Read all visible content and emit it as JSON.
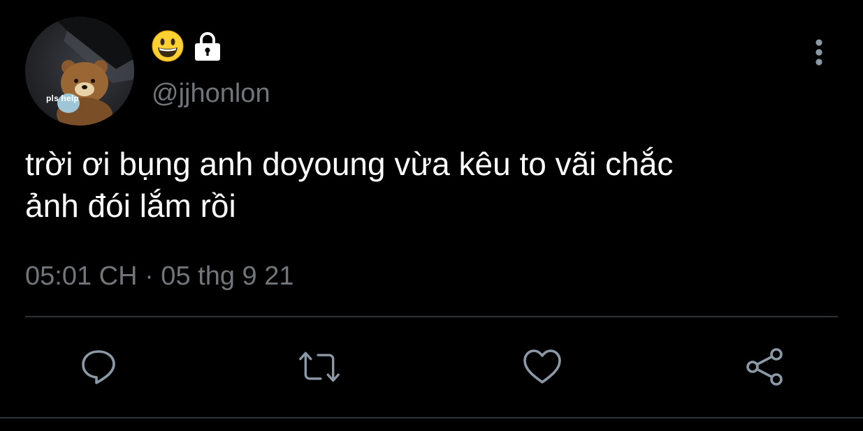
{
  "author": {
    "avatar_caption": "pls help",
    "display_name_emojis": [
      "grinning-face-emoji",
      "lock-icon"
    ],
    "handle": "@jjhonlon"
  },
  "tweet": {
    "text": "trời ơi bụng anh doyoung vừa kêu to vãi chắc\nảnh đói lắm rồi",
    "timestamp": "05:01 CH · 05 thg 9 21"
  },
  "actions": [
    "reply-icon",
    "retweet-icon",
    "like-icon",
    "share-icon"
  ],
  "colors": {
    "background": "#000000",
    "primary_text": "#ffffff",
    "secondary_text": "#71767b",
    "icon": "#8b98a5",
    "divider": "#2f3336"
  }
}
